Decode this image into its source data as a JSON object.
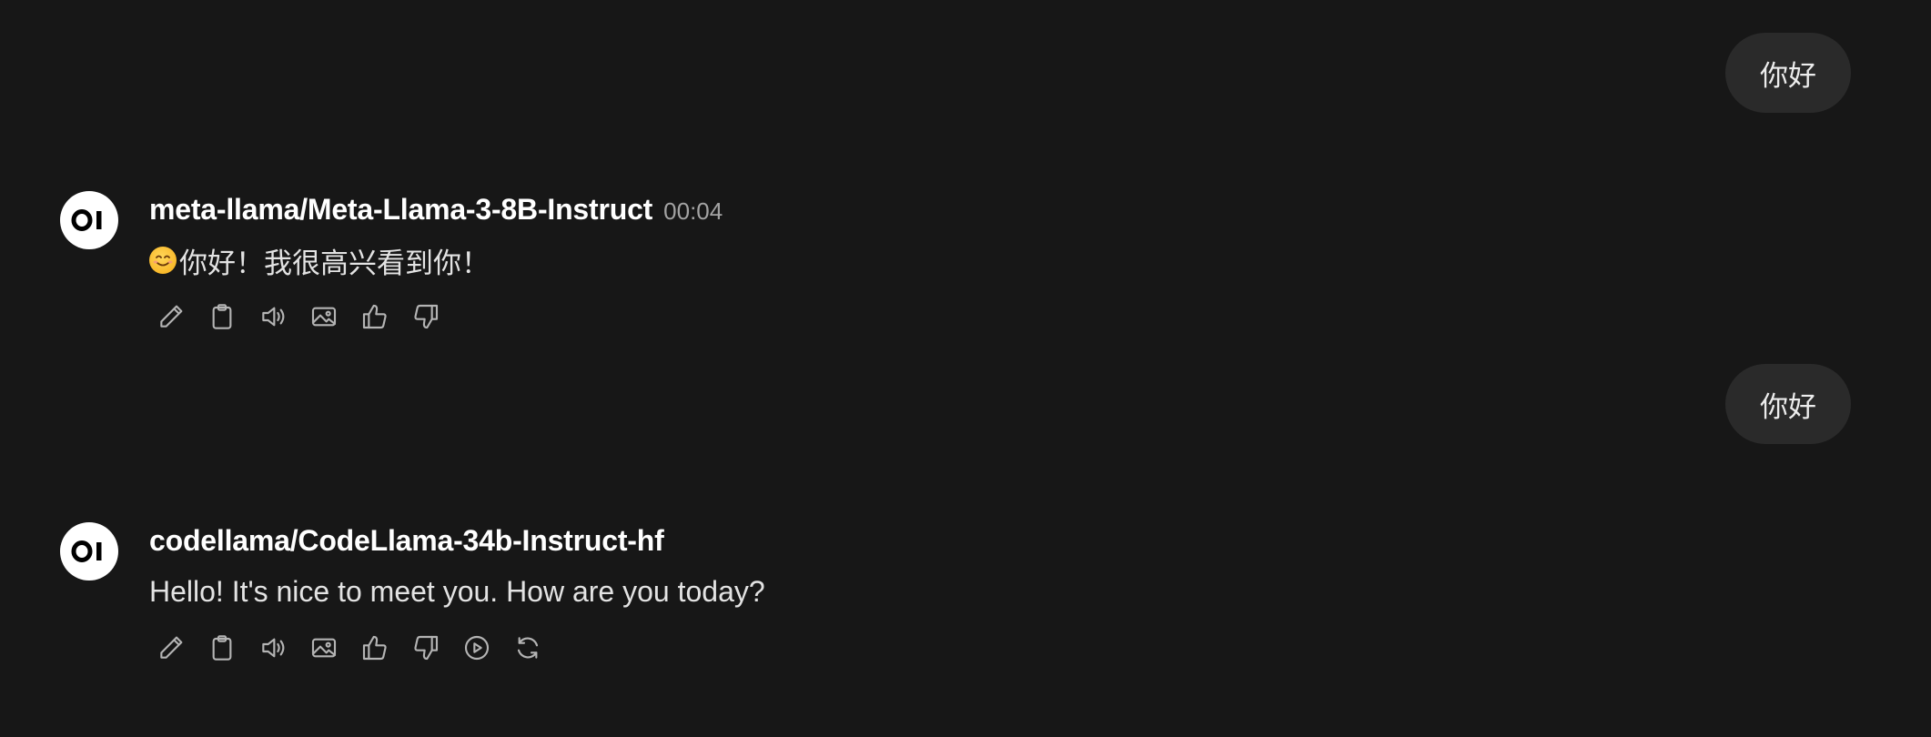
{
  "messages": [
    {
      "role": "user",
      "text": "你好"
    },
    {
      "role": "assistant",
      "model": "meta-llama/Meta-Llama-3-8B-Instruct",
      "timestamp": "00:04",
      "emoji": "smiling-face-emoji",
      "text": "你好！我很高兴看到你！",
      "actions": [
        "edit-icon",
        "copy-icon",
        "read-aloud-icon",
        "image-icon",
        "thumbs-up-icon",
        "thumbs-down-icon"
      ]
    },
    {
      "role": "user",
      "text": "你好"
    },
    {
      "role": "assistant",
      "model": "codellama/CodeLlama-34b-Instruct-hf",
      "timestamp": "",
      "text": "Hello! It's nice to meet you. How are you today?",
      "actions": [
        "edit-icon",
        "copy-icon",
        "read-aloud-icon",
        "image-icon",
        "thumbs-up-icon",
        "thumbs-down-icon",
        "continue-icon",
        "regenerate-icon"
      ]
    }
  ],
  "colors": {
    "background": "#171717",
    "user_bubble": "#2a2a2a",
    "text": "#ececec",
    "icon": "#b4b4b4",
    "timestamp": "#a3a3a3"
  }
}
